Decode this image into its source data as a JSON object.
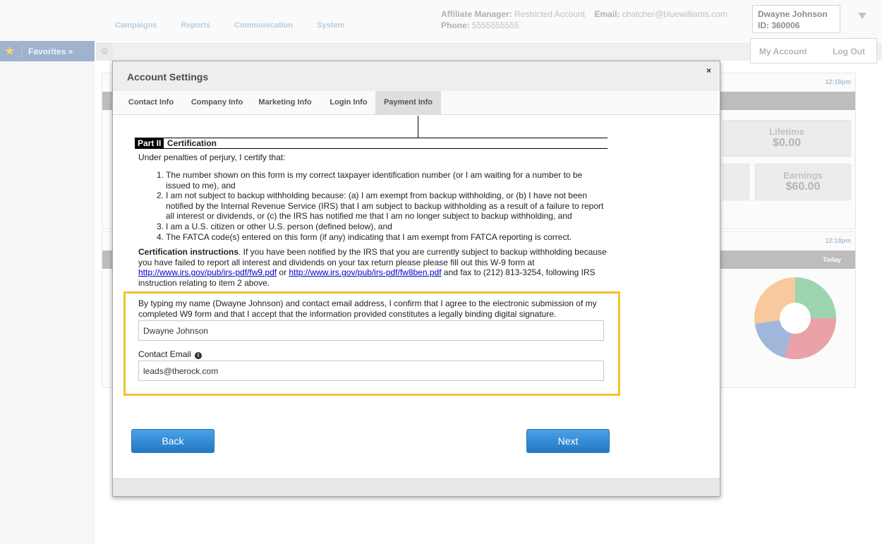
{
  "nav": [
    "Campaigns",
    "Reports",
    "Communication",
    "System"
  ],
  "affiliate": {
    "manager_label": "Affiliate Manager:",
    "manager_value": "Restricted Account",
    "email_label": "Email:",
    "email_value": "chatcher@bluewilliams.com",
    "phone_label": "Phone:",
    "phone_value": "5555555555"
  },
  "user": {
    "name": "Dwayne Johnson",
    "id": "ID: 360006"
  },
  "account_menu": {
    "my_account": "My Account",
    "logout": "Log Out"
  },
  "favorites": {
    "label": "Favorites »"
  },
  "panels": {
    "time1": "12:18pm",
    "time2": "12:18pm",
    "lifetime_label": "Lifetime",
    "lifetime_value": "$0.00",
    "earnings_label": "Earnings",
    "earnings_value": "$60.00",
    "today": "Today"
  },
  "donut_colors": [
    "#9dd4b0",
    "#e8a2a8",
    "#9fb8dc",
    "#f7c99c"
  ],
  "modal": {
    "title": "Account Settings",
    "close": "×",
    "tabs": [
      "Contact Info",
      "Company Info",
      "Marketing Info",
      "Login Info",
      "Payment Info"
    ],
    "active_tab": "Payment Info",
    "part_label": "Part II",
    "part_title": "Certification",
    "under_penalties": "Under penalties of perjury, I certify that:",
    "items": [
      {
        "num": "1.",
        "text": "The number shown on this form is my correct taxpayer identification number (or I am waiting for a number to be issued to me), and"
      },
      {
        "num": "2.",
        "text": "I am not subject to backup withholding because: (a) I am exempt from backup withholding, or (b) I have not been notified by the Internal Revenue Service (IRS) that I am subject to backup withholding as a result of a failure to report all interest or dividends, or (c) the IRS has notified me that I am no longer subject to backup withholding, and"
      },
      {
        "num": "3.",
        "text": "I am a U.S. citizen or other U.S. person (defined below), and"
      },
      {
        "num": "4.",
        "text": "The FATCA code(s) entered on this form (if any) indicating that I am exempt from FATCA reporting is correct."
      }
    ],
    "instr_bold": "Certification instructions",
    "instr_text1": ". If you have been notified by the IRS that you are currently subject to backup withholding because you have failed to report all interest and dividends on your tax return please please fill out this W-9 form at ",
    "link1": "http://www.irs.gov/pub/irs-pdf/fw9.pdf",
    "instr_or": " or ",
    "link2": "http://www.irs.gov/pub/irs-pdf/fw8ben.pdf",
    "instr_text2": " and fax to (212) 813-3254, following IRS instruction relating to item 2 above.",
    "agree_text": "By typing my name (Dwayne Johnson) and contact email address, I confirm that I agree to the electronic submission of my completed W9 form and that I accept that the information provided constitutes a legally binding digital signature.",
    "name_value": "Dwayne Johnson",
    "email_label": "Contact Email",
    "email_value": "leads@therock.com",
    "back": "Back",
    "next": "Next"
  }
}
